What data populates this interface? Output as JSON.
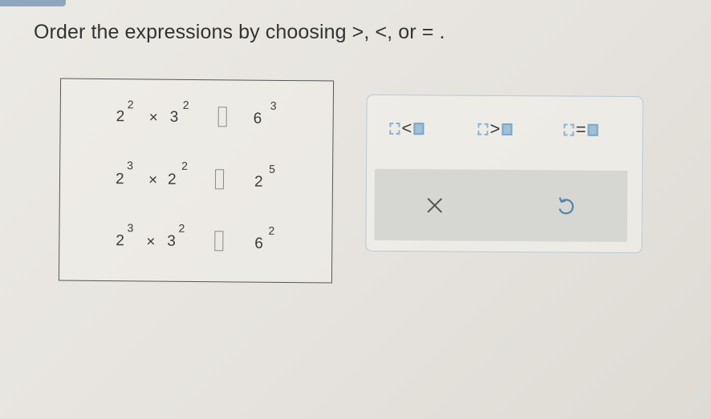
{
  "instruction": "Order the expressions by choosing >, <, or = .",
  "rows": [
    {
      "left": {
        "b1": "2",
        "e1": "2",
        "op": "×",
        "b2": "3",
        "e2": "2"
      },
      "right": {
        "b": "6",
        "e": "3"
      }
    },
    {
      "left": {
        "b1": "2",
        "e1": "3",
        "op": "×",
        "b2": "2",
        "e2": "2"
      },
      "right": {
        "b": "2",
        "e": "5"
      }
    },
    {
      "left": {
        "b1": "2",
        "e1": "3",
        "op": "×",
        "b2": "3",
        "e2": "2"
      },
      "right": {
        "b": "6",
        "e": "2"
      }
    }
  ],
  "palette": {
    "less": "<",
    "greater": ">",
    "equal": "="
  },
  "colors": {
    "accent": "#7fa6c5",
    "panel_border": "#b9c9d8",
    "action_bar": "#d6d6d2"
  },
  "icons": {
    "clear": "close-icon",
    "undo": "undo-icon"
  }
}
